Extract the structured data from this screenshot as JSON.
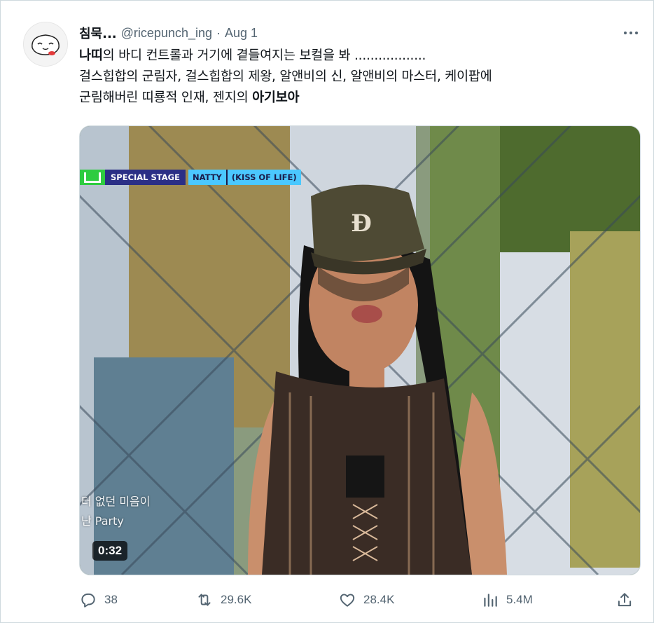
{
  "tweet": {
    "display_name": "침묵...",
    "handle": "@ricepunch_ing",
    "separator": "·",
    "date": "Aug 1",
    "text": {
      "line1_bold": "나띠",
      "line1_rest": "의 바디 컨트롤과 거기에 곁들여지는 보컬을 봐 ..................",
      "line2": "걸스힙합의 군림자, 걸스힙합의 제왕, 알앤비의 신, 알앤비의 마스터, 케이팝에",
      "line3_rest": "군림해버린 띠룡적 인재, 젠지의 ",
      "line3_bold": "아기보아"
    }
  },
  "video": {
    "banner_stage": "SPECIAL STAGE",
    "banner_name": "NATTY",
    "banner_group": "(KISS OF LIFE)",
    "subtitle_line1": "터 없던 미음이",
    "subtitle_line2": "난 Party",
    "timestamp": "0:32"
  },
  "actions": {
    "replies": "38",
    "retweets": "29.6K",
    "likes": "28.4K",
    "views": "5.4M"
  },
  "icons": {
    "reply": "reply-bubble-icon",
    "retweet": "retweet-arrows-icon",
    "like": "heart-icon",
    "views": "bar-chart-icon",
    "share": "share-upload-icon",
    "more": "more-dots-icon"
  },
  "colors": {
    "secondary_text": "#536471",
    "border": "#cfd9de",
    "primary_text": "#0f1419"
  }
}
